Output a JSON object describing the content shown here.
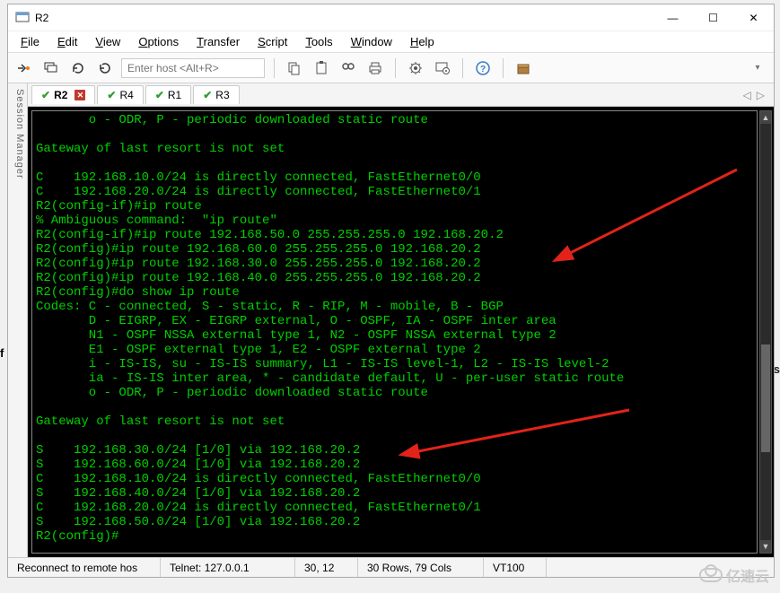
{
  "title": "R2",
  "win_controls": {
    "min": "—",
    "max": "☐",
    "close": "✕"
  },
  "menu": [
    "File",
    "Edit",
    "View",
    "Options",
    "Transfer",
    "Script",
    "Tools",
    "Window",
    "Help"
  ],
  "menu_ul": [
    "F",
    "E",
    "V",
    "O",
    "T",
    "S",
    "T",
    "W",
    "H"
  ],
  "host_placeholder": "Enter host <Alt+R>",
  "session_manager": "Session Manager",
  "tabs": [
    {
      "label": "R2",
      "active": true
    },
    {
      "label": "R4",
      "active": false
    },
    {
      "label": "R1",
      "active": false
    },
    {
      "label": "R3",
      "active": false
    }
  ],
  "terminal_lines": [
    "       o - ODR, P - periodic downloaded static route",
    "",
    "Gateway of last resort is not set",
    "",
    "C    192.168.10.0/24 is directly connected, FastEthernet0/0",
    "C    192.168.20.0/24 is directly connected, FastEthernet0/1",
    "R2(config-if)#ip route",
    "% Ambiguous command:  \"ip route\"",
    "R2(config-if)#ip route 192.168.50.0 255.255.255.0 192.168.20.2",
    "R2(config)#ip route 192.168.60.0 255.255.255.0 192.168.20.2",
    "R2(config)#ip route 192.168.30.0 255.255.255.0 192.168.20.2",
    "R2(config)#ip route 192.168.40.0 255.255.255.0 192.168.20.2",
    "R2(config)#do show ip route",
    "Codes: C - connected, S - static, R - RIP, M - mobile, B - BGP",
    "       D - EIGRP, EX - EIGRP external, O - OSPF, IA - OSPF inter area",
    "       N1 - OSPF NSSA external type 1, N2 - OSPF NSSA external type 2",
    "       E1 - OSPF external type 1, E2 - OSPF external type 2",
    "       i - IS-IS, su - IS-IS summary, L1 - IS-IS level-1, L2 - IS-IS level-2",
    "       ia - IS-IS inter area, * - candidate default, U - per-user static route",
    "       o - ODR, P - periodic downloaded static route",
    "",
    "Gateway of last resort is not set",
    "",
    "S    192.168.30.0/24 [1/0] via 192.168.20.2",
    "S    192.168.60.0/24 [1/0] via 192.168.20.2",
    "C    192.168.10.0/24 is directly connected, FastEthernet0/0",
    "S    192.168.40.0/24 [1/0] via 192.168.20.2",
    "C    192.168.20.0/24 is directly connected, FastEthernet0/1",
    "S    192.168.50.0/24 [1/0] via 192.168.20.2",
    "R2(config)#"
  ],
  "status": {
    "reconnect": "Reconnect to remote hos",
    "protocol": "Telnet: 127.0.0.1",
    "cursor": "30,  12",
    "dims": "30 Rows, 79 Cols",
    "term": "VT100"
  },
  "watermark": "亿速云",
  "ext": {
    "f": "f",
    "s": "s"
  }
}
